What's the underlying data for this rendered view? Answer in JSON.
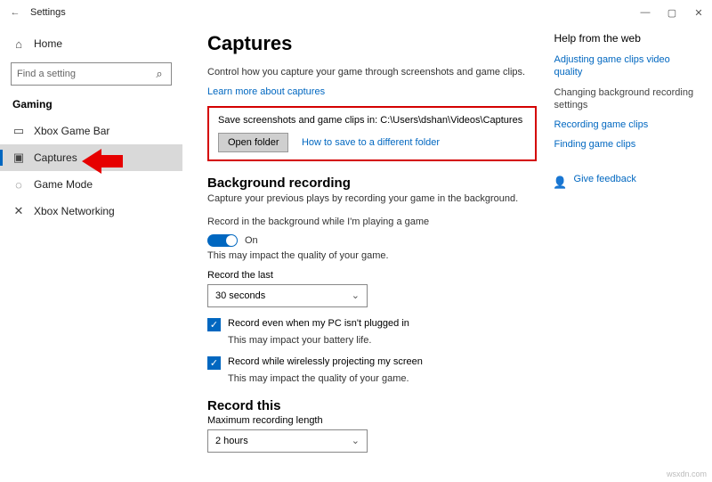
{
  "titlebar": {
    "label": "Settings"
  },
  "home": {
    "label": "Home"
  },
  "search": {
    "placeholder": "Find a setting"
  },
  "section": "Gaming",
  "nav": [
    {
      "label": "Xbox Game Bar"
    },
    {
      "label": "Captures"
    },
    {
      "label": "Game Mode"
    },
    {
      "label": "Xbox Networking"
    }
  ],
  "page": {
    "title": "Captures",
    "desc": "Control how you capture your game through screenshots and game clips.",
    "learn_link": "Learn more about captures",
    "save_label": "Save screenshots and game clips in: C:\\Users\\dshan\\Videos\\Captures",
    "open_folder": "Open folder",
    "diff_folder": "How to save to a different folder",
    "bg_heading": "Background recording",
    "bg_desc": "Capture your previous plays by recording your game in the background.",
    "bg_toggle_label": "Record in the background while I'm playing a game",
    "toggle_on": "On",
    "bg_impact": "This may impact the quality of your game.",
    "record_last_label": "Record the last",
    "record_last_value": "30 seconds",
    "check1": "Record even when my PC isn't plugged in",
    "check1_impact": "This may impact your battery life.",
    "check2": "Record while wirelessly projecting my screen",
    "check2_impact": "This may impact the quality of your game.",
    "record_this_heading": "Record this",
    "max_len_label": "Maximum recording length",
    "max_len_value": "2 hours"
  },
  "help": {
    "heading": "Help from the web",
    "l1": "Adjusting game clips video quality",
    "l2": "Changing background recording settings",
    "l3": "Recording game clips",
    "l4": "Finding game clips",
    "feedback": "Give feedback"
  },
  "attribution": "wsxdn.com"
}
